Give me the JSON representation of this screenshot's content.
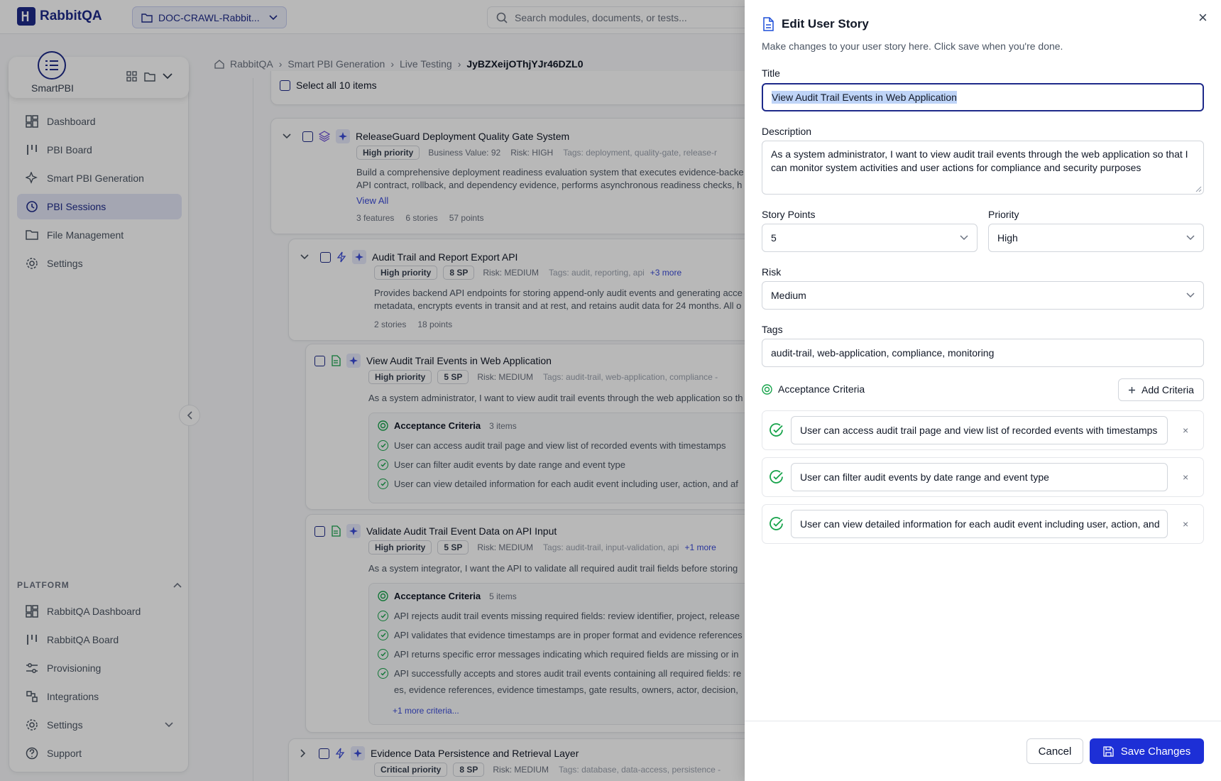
{
  "topbar": {
    "logo": "RabbitQA",
    "project": "DOC-CRAWL-Rabbit...",
    "search_placeholder": "Search modules, documents, or tests..."
  },
  "sidebar": {
    "brand": "SmartPBI",
    "items": [
      "Dashboard",
      "PBI Board",
      "Smart PBI Generation",
      "PBI Sessions",
      "File Management",
      "Settings"
    ],
    "platform_header": "PLATFORM",
    "platform_items": [
      "RabbitQA Dashboard",
      "RabbitQA Board",
      "Provisioning",
      "Integrations",
      "Settings",
      "Support"
    ]
  },
  "breadcrumb": [
    "RabbitQA",
    "Smart PBI Generation",
    "Live Testing",
    "JyBZXeijOThjYJr46DZL0"
  ],
  "select_all": "Select all 10 items",
  "epic": {
    "title": "ReleaseGuard Deployment Quality Gate System",
    "priority": "High priority",
    "value": "Business Value: 92",
    "risk": "Risk: HIGH",
    "tags": "Tags: deployment, quality-gate, release-r",
    "desc1": "Build a comprehensive deployment readiness evaluation system that executes evidence-backe",
    "desc2": "API contract, rollback, and dependency evidence, performs asynchronous readiness checks, h",
    "view_all": "View All",
    "features": "3 features",
    "stories": "6 stories",
    "points": "57 points"
  },
  "feature": {
    "title": "Audit Trail and Report Export API",
    "priority": "High priority",
    "sp": "8 SP",
    "risk": "Risk: MEDIUM",
    "tags": "Tags: audit, reporting, api",
    "more": "+3 more",
    "desc1": "Provides backend API endpoints for storing append-only audit events and generating acce",
    "desc2": "metadata, encrypts events in transit and at rest, and retains audit data for 24 months. All o",
    "stories": "2 stories",
    "points": "18 points"
  },
  "story1": {
    "title": "View Audit Trail Events in Web Application",
    "priority": "High priority",
    "sp": "5 SP",
    "risk": "Risk: MEDIUM",
    "tags": "Tags: audit-trail, web-application, compliance -",
    "desc": "As a system administrator, I want to view audit trail events through the web application so th",
    "ac_label": "Acceptance Criteria",
    "ac_count": "3 items",
    "ac": [
      "User can access audit trail page and view list of recorded events with timestamps",
      "User can filter audit events by date range and event type",
      "User can view detailed information for each audit event including user, action, and af"
    ]
  },
  "story2": {
    "title": "Validate Audit Trail Event Data on API Input",
    "priority": "High priority",
    "sp": "5 SP",
    "risk": "Risk: MEDIUM",
    "tags": "Tags: audit-trail, input-validation, api",
    "more": "+1 more",
    "desc": "As a system integrator, I want the API to validate all required audit trail fields before storing",
    "ac_label": "Acceptance Criteria",
    "ac_count": "5 items",
    "ac": [
      "API rejects audit trail events missing required fields: review identifier, project, release",
      "API validates that evidence timestamps are in proper format and evidence references",
      "API returns specific error messages indicating which required fields are missing or in",
      "API successfully accepts and stores audit trail events containing all required fields: re",
      "es, evidence references, evidence timestamps, gate results, owners, actor, decision,"
    ],
    "more_criteria": "+1 more criteria..."
  },
  "feature3": {
    "title": "Evidence Data Persistence and Retrieval Layer",
    "priority": "Critical priority",
    "sp": "8 SP",
    "risk": "Risk: MEDIUM",
    "tags": "Tags: database, data-access, persistence -"
  },
  "drawer": {
    "title": "Edit User Story",
    "subtitle": "Make changes to your user story here. Click save when you're done.",
    "title_label": "Title",
    "title_value": "View Audit Trail Events in Web Application",
    "desc_label": "Description",
    "desc_value": "As a system administrator, I want to view audit trail events through the web application so that I can monitor system activities and user actions for compliance and security purposes",
    "sp_label": "Story Points",
    "sp_value": "5",
    "priority_label": "Priority",
    "priority_value": "High",
    "risk_label": "Risk",
    "risk_value": "Medium",
    "tags_label": "Tags",
    "tags_value": "audit-trail, web-application, compliance, monitoring",
    "ac_label": "Acceptance Criteria",
    "add_criteria": "Add Criteria",
    "criteria": [
      "User can access audit trail page and view list of recorded events with timestamps",
      "User can filter audit events by date range and event type",
      "User can view detailed information for each audit event including user, action, and"
    ],
    "cancel": "Cancel",
    "save": "Save Changes",
    "close_glyph": "×",
    "remove_glyph": "×"
  },
  "colors": {
    "accent": "#1e2a8a",
    "primary_button": "#1d2fd6",
    "success": "#16a34a",
    "selection": "#bfd4f7"
  }
}
